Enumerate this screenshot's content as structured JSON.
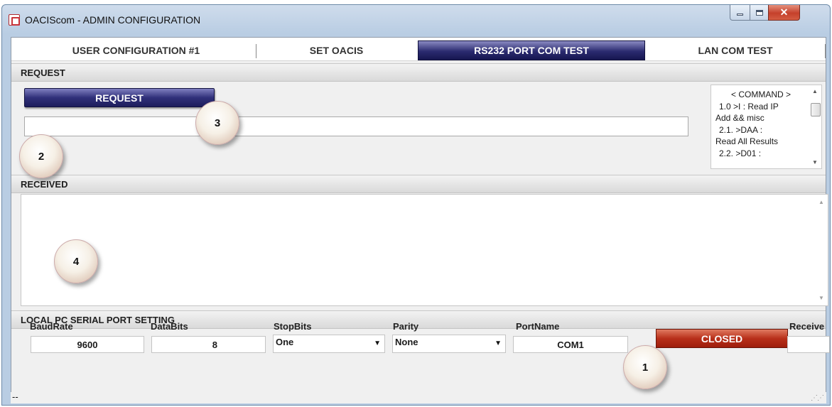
{
  "window": {
    "title": "OACIScom - ADMIN CONFIGURATION"
  },
  "tabs": [
    {
      "label": "USER CONFIGURATION #1"
    },
    {
      "label": "SET OACIS"
    },
    {
      "label": "RS232 PORT COM TEST",
      "selected": true
    },
    {
      "label": "LAN COM TEST"
    }
  ],
  "request": {
    "header": "REQUEST",
    "button_label": "REQUEST",
    "input_value": "",
    "command_list": [
      "< COMMAND >",
      "1.0  >I :  Read IP",
      "Add && misc",
      "2.1.  >DAA :",
      "Read All Results",
      "2.2.  >D01  :"
    ]
  },
  "received": {
    "header": "RECEIVED",
    "text": ""
  },
  "serial": {
    "header": "LOCAL PC SERIAL PORT SETTING",
    "baudrate_label": "BaudRate",
    "baudrate_value": "9600",
    "databits_label": "DataBits",
    "databits_value": "8",
    "stopbits_label": "StopBits",
    "stopbits_value": "One",
    "parity_label": "Parity",
    "parity_value": "None",
    "portname_label": "PortName",
    "portname_value": "COM1",
    "status_button": "CLOSED",
    "receive_label": "Receive"
  },
  "statusbar": {
    "text": "--"
  },
  "callouts": [
    "1",
    "2",
    "3",
    "4"
  ],
  "colors": {
    "selected_tab": "#2b2b70",
    "request_button": "#30307a",
    "closed_button": "#b8301a"
  }
}
